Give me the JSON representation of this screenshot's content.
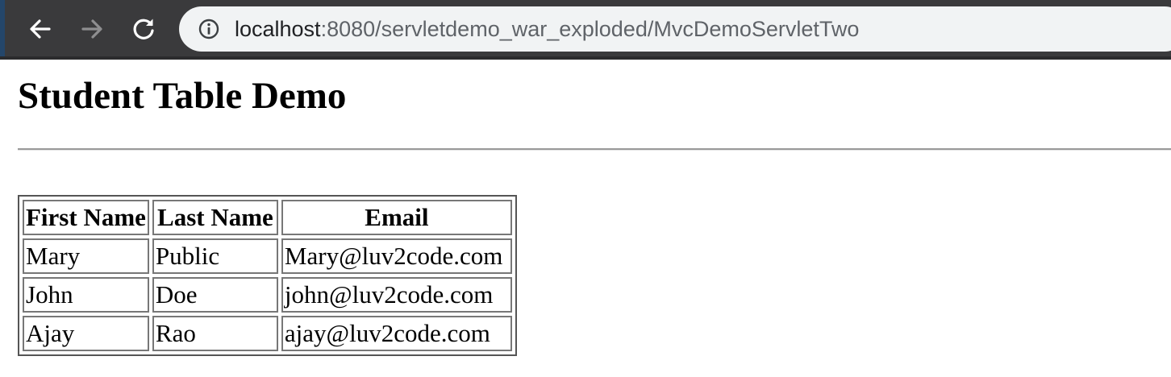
{
  "browser": {
    "url_host": "localhost",
    "url_rest": ":8080/servletdemo_war_exploded/MvcDemoServletTwo",
    "icons": {
      "back": "back-arrow-icon",
      "forward": "forward-arrow-icon",
      "reload": "reload-icon",
      "site_info": "info-icon"
    },
    "colors": {
      "toolbar": "#3a3a3c",
      "omnibox": "#f1f3f4"
    }
  },
  "page": {
    "title": "Student Table Demo"
  },
  "table": {
    "headers": {
      "first_name": "First Name",
      "last_name": "Last Name",
      "email": "Email"
    },
    "rows": [
      {
        "first_name": "Mary",
        "last_name": "Public",
        "email": "Mary@luv2code.com"
      },
      {
        "first_name": "John",
        "last_name": "Doe",
        "email": "john@luv2code.com"
      },
      {
        "first_name": "Ajay",
        "last_name": "Rao",
        "email": "ajay@luv2code.com"
      }
    ]
  }
}
